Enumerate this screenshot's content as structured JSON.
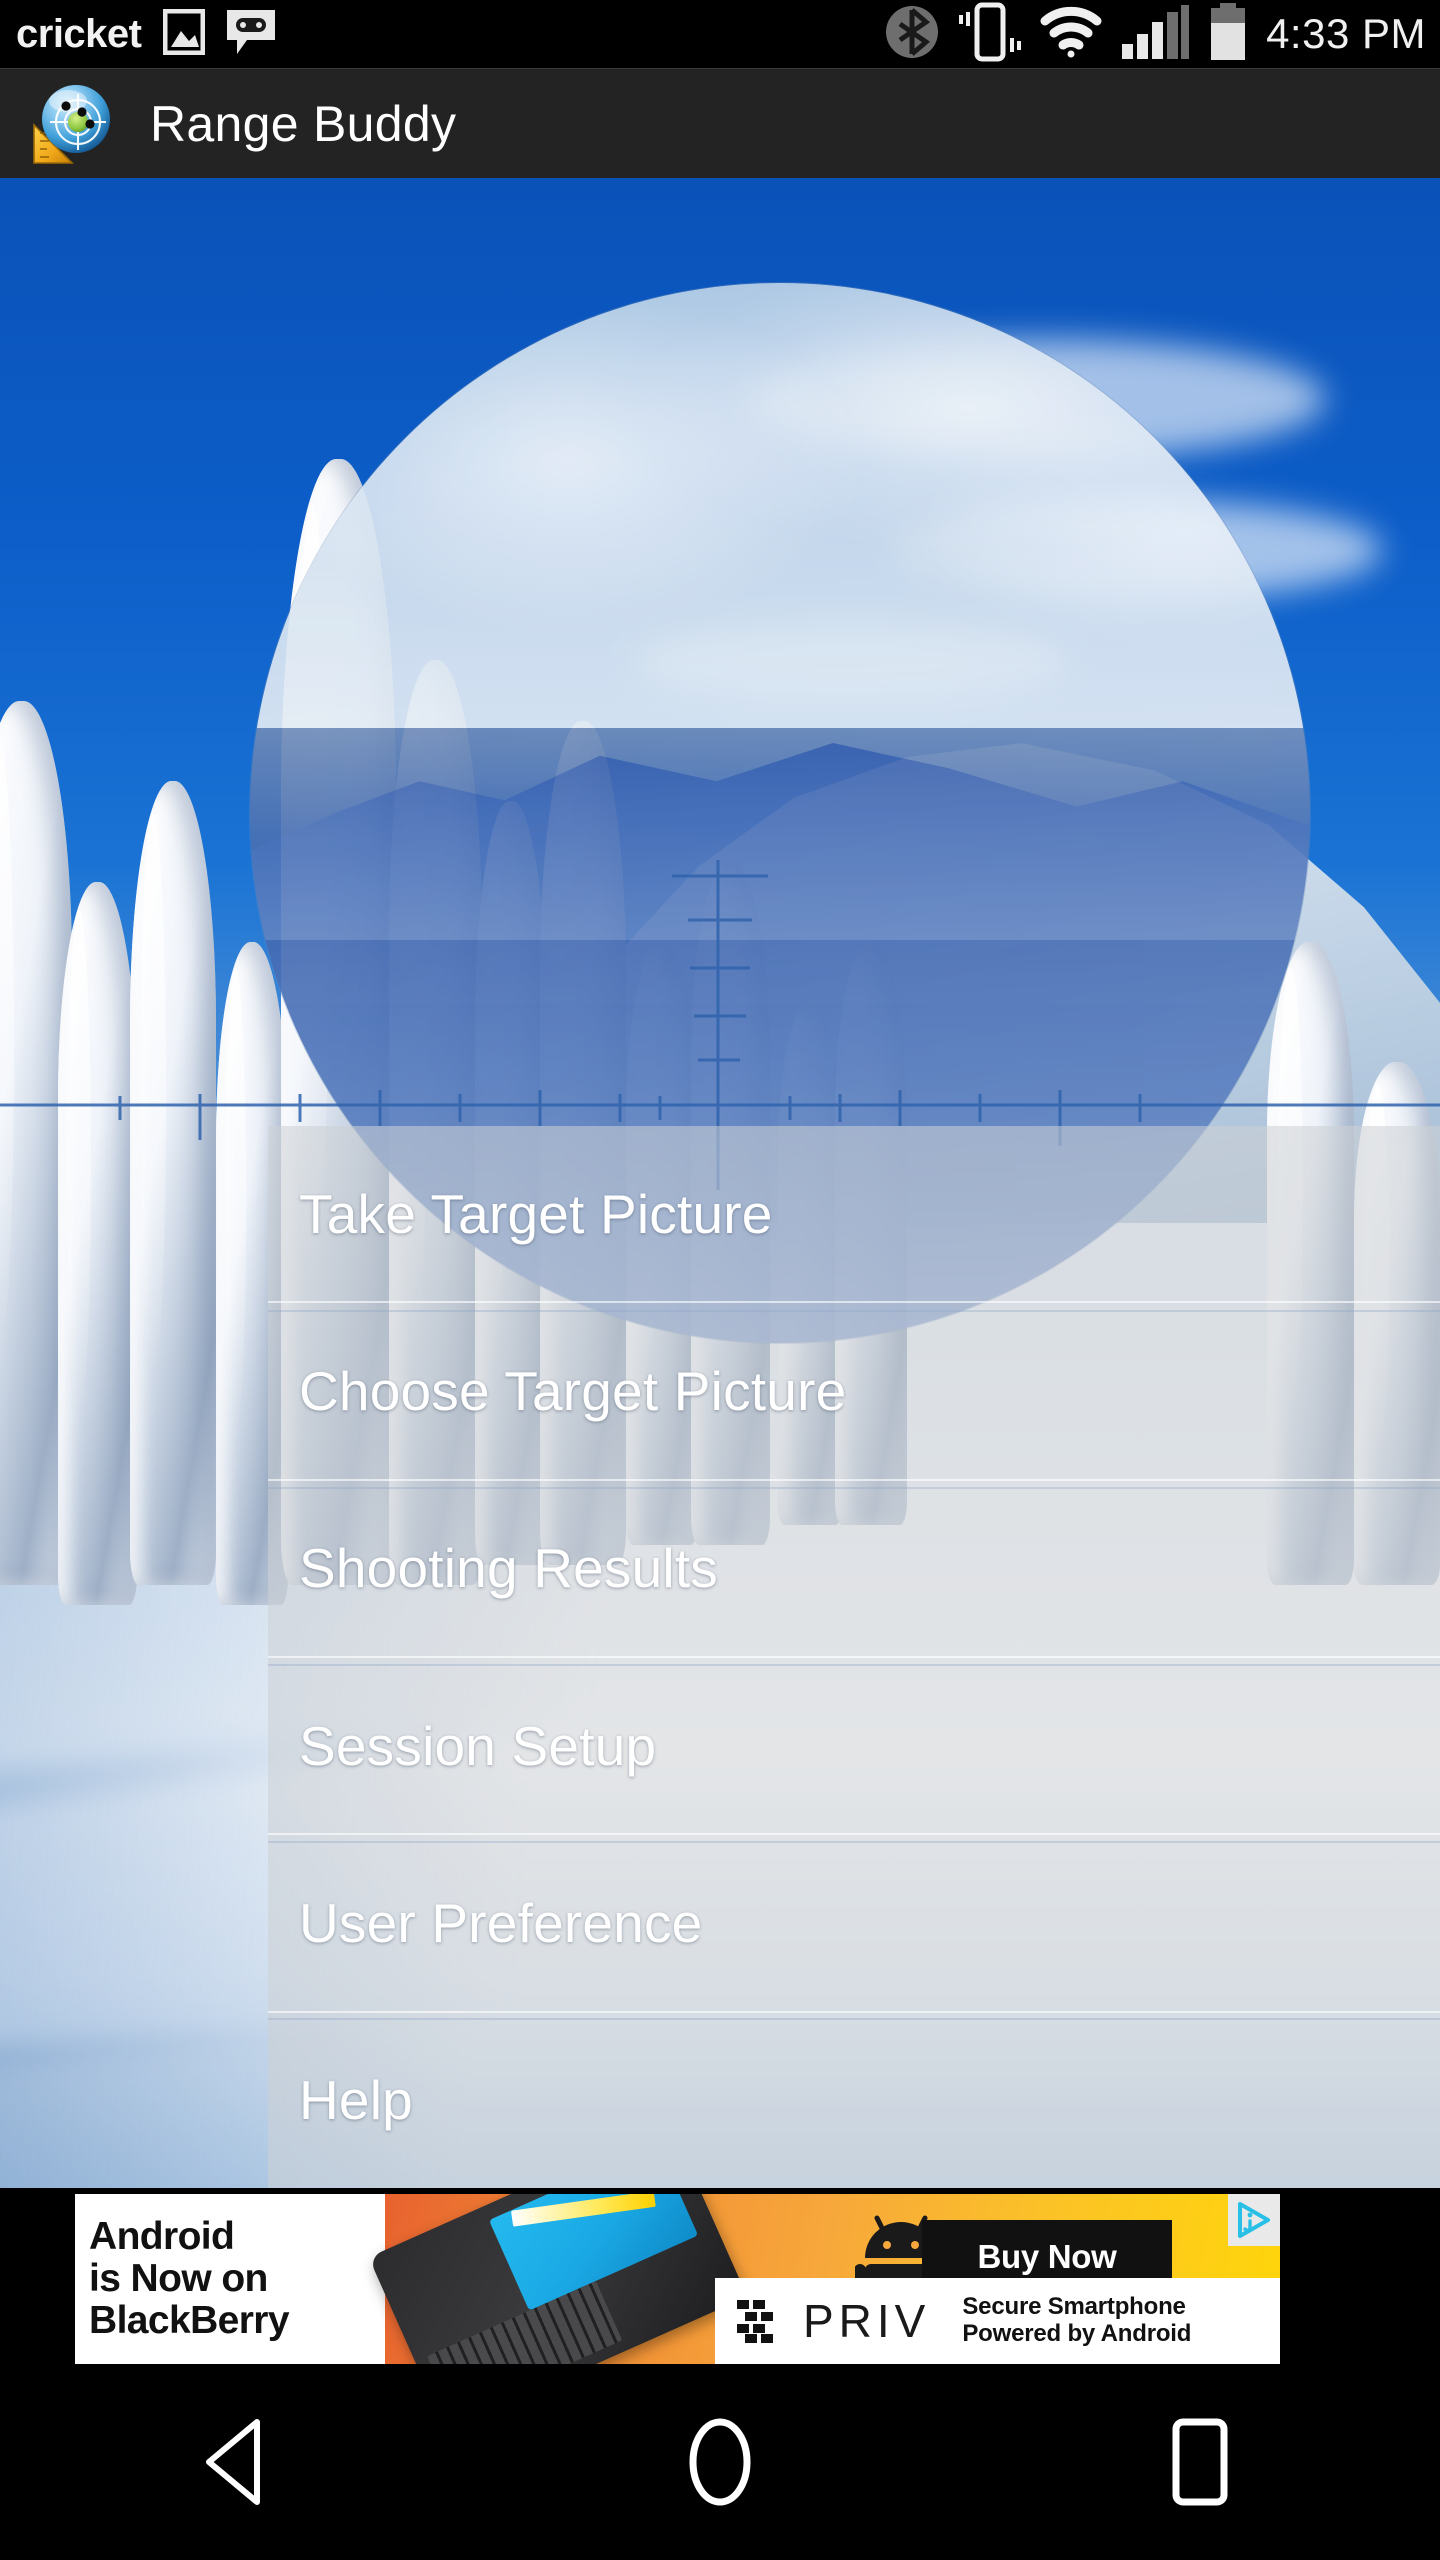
{
  "status_bar": {
    "carrier": "cricket",
    "clock": "4:33 PM",
    "icons": [
      "gallery-icon",
      "voicemail-icon",
      "bluetooth-icon",
      "vibrate-icon",
      "wifi-icon",
      "cellular-signal-icon",
      "battery-icon"
    ]
  },
  "app_bar": {
    "title": "Range Buddy",
    "logo": "range-buddy-logo"
  },
  "menu": {
    "items": [
      {
        "label": "Take Target Picture"
      },
      {
        "label": "Choose Target Picture"
      },
      {
        "label": "Shooting Results"
      },
      {
        "label": "Session Setup"
      },
      {
        "label": "User Preference"
      },
      {
        "label": "Help"
      }
    ]
  },
  "ad": {
    "headline_lines": [
      "Android",
      "is Now on",
      "BlackBerry"
    ],
    "cta_label": "Buy Now",
    "product": "PRIV",
    "tagline_line1": "Secure Smartphone",
    "tagline_line2": "Powered by Android",
    "adchoices_label": "AdChoices"
  },
  "nav_bar": {
    "back_label": "Back",
    "home_label": "Home",
    "recents_label": "Recent apps"
  },
  "colors": {
    "status_bar_bg": "#000000",
    "app_bar_bg": "#232323",
    "menu_overlay": "rgba(205,208,212,0.56)",
    "menu_text": "#ffffff",
    "ad_orange": "#f4a03c",
    "ad_yellow": "#ffd60a",
    "adchoices_blue": "#29c0e8",
    "reticle_blue": "#2f63ad"
  }
}
